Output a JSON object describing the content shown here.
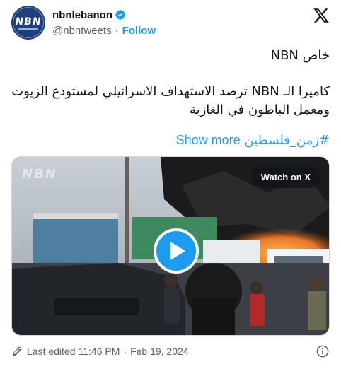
{
  "author": {
    "display_name": "nbnlebanon",
    "handle": "@nbntweets",
    "separator": "·",
    "follow_label": "Follow",
    "avatar_text": "NBN"
  },
  "tweet": {
    "line1": "خاص NBN",
    "line2": "كاميرا الـ NBN ترصد الاستهداف الاسرائيلي لمستودع الزيوت ومعمل الباطون في الغازية",
    "hashtag": "#زمن_فلسطين",
    "show_more": "Show more"
  },
  "media": {
    "watch_label": "Watch on X",
    "watermark": "NBN"
  },
  "footer": {
    "edited_label": "Last edited",
    "time": "11:46 PM",
    "separator": "·",
    "date": "Feb 19, 2024"
  },
  "colors": {
    "link": "#1d9bf0",
    "secondary_text": "#536471",
    "avatar_bg": "#1e3f7a"
  }
}
